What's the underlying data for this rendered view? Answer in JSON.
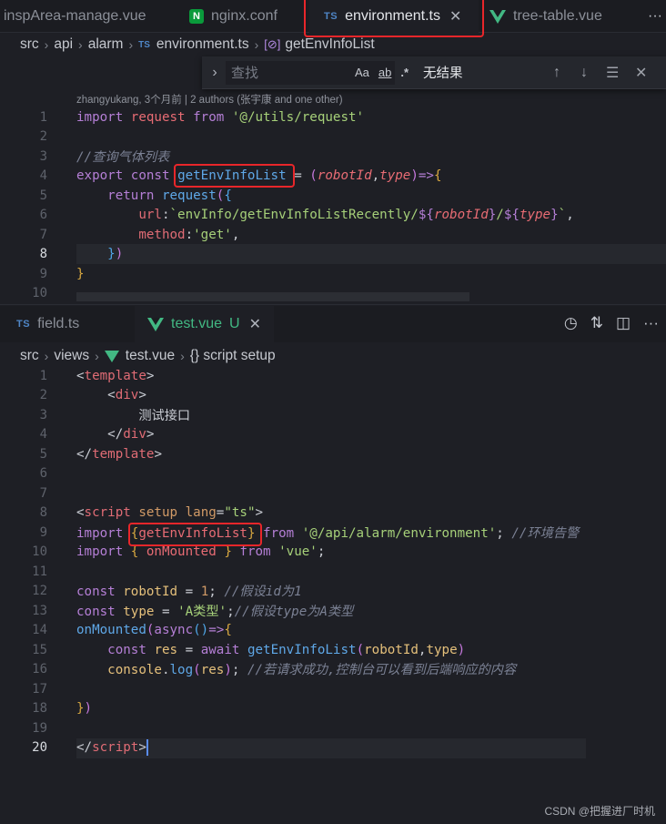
{
  "top_tabs": [
    {
      "label": "inspArea-manage.vue",
      "icon": "vue-icon",
      "active": false
    },
    {
      "label": "nginx.conf",
      "icon": "nginx-icon",
      "active": false
    },
    {
      "label": "environment.ts",
      "icon": "ts-icon",
      "active": true
    },
    {
      "label": "tree-table.vue",
      "icon": "vue-icon",
      "active": false
    }
  ],
  "top_breadcrumb": {
    "parts": [
      "src",
      "api",
      "alarm"
    ],
    "file_badge": "TS",
    "file": "environment.ts",
    "symbol": "getEnvInfoList"
  },
  "find": {
    "placeholder": "查找",
    "match_case": "Aa",
    "whole_word": "ab",
    "regex": ".*",
    "result": "无结果"
  },
  "blame": "zhangyukang, 3个月前 | 2 authors (张宇康 and one other)",
  "top_code": {
    "line_numbers": [
      "1",
      "2",
      "3",
      "4",
      "5",
      "6",
      "7",
      "8",
      "9",
      "10"
    ],
    "current_line": "8",
    "l1_import": "import",
    "l1_request": "request",
    "l1_from": "from",
    "l1_path": "'@/utils/request'",
    "l3_comment": "//查询气体列表",
    "l4_export": "export",
    "l4_const": "const",
    "l4_name": "getEnvInfoList",
    "l4_eq": " = ",
    "l4_p1": "robotId",
    "l4_p2": "type",
    "l5_return": "return",
    "l5_request": "request",
    "l6_url_key": "url",
    "l6_url_val_a": "`envInfo/getEnvInfoListRecently/",
    "l6_p1": "robotId",
    "l6_p2": "type",
    "l7_method_key": "method",
    "l7_method_val": "'get'"
  },
  "bottom_tabs": [
    {
      "label": "field.ts",
      "icon": "ts-icon",
      "active": false
    },
    {
      "label": "test.vue",
      "status": "U",
      "icon": "vue-icon",
      "active": true
    }
  ],
  "bottom_breadcrumb": {
    "parts": [
      "src",
      "views"
    ],
    "file": "test.vue",
    "symbol": "{} script setup"
  },
  "bottom_code": {
    "line_numbers": [
      "1",
      "2",
      "3",
      "4",
      "5",
      "6",
      "7",
      "8",
      "9",
      "10",
      "11",
      "12",
      "13",
      "14",
      "15",
      "16",
      "17",
      "18",
      "19",
      "20"
    ],
    "current_line": "20",
    "l1": "template",
    "l2": "div",
    "l3": "测试接口",
    "l4": "div",
    "l5": "template",
    "l8_tag": "script",
    "l8_setup": "setup",
    "l8_lang": "lang",
    "l8_val": "\"ts\"",
    "l9_import": "import",
    "l9_name": "getEnvInfoList",
    "l9_from": "from",
    "l9_path": "'@/api/alarm/environment'",
    "l9_cmt": "//环境告警",
    "l10_import": "import",
    "l10_name": "onMounted",
    "l10_from": "from",
    "l10_path": "'vue'",
    "l12_const": "const",
    "l12_name": "robotId",
    "l12_val": "1",
    "l12_cmt": "//假设id为1",
    "l13_const": "const",
    "l13_name": "type",
    "l13_val": "'A类型'",
    "l13_cmt": "//假设type为A类型",
    "l14_fn": "onMounted",
    "l14_async": "async",
    "l15_const": "const",
    "l15_name": "res",
    "l15_await": "await",
    "l15_fn": "getEnvInfoList",
    "l15_a1": "robotId",
    "l15_a2": "type",
    "l16_console": "console",
    "l16_log": "log",
    "l16_arg": "res",
    "l16_cmt": "//若请求成功,控制台可以看到后端响应的内容",
    "l20_tag": "script"
  },
  "watermark": "CSDN @把握进厂时机"
}
